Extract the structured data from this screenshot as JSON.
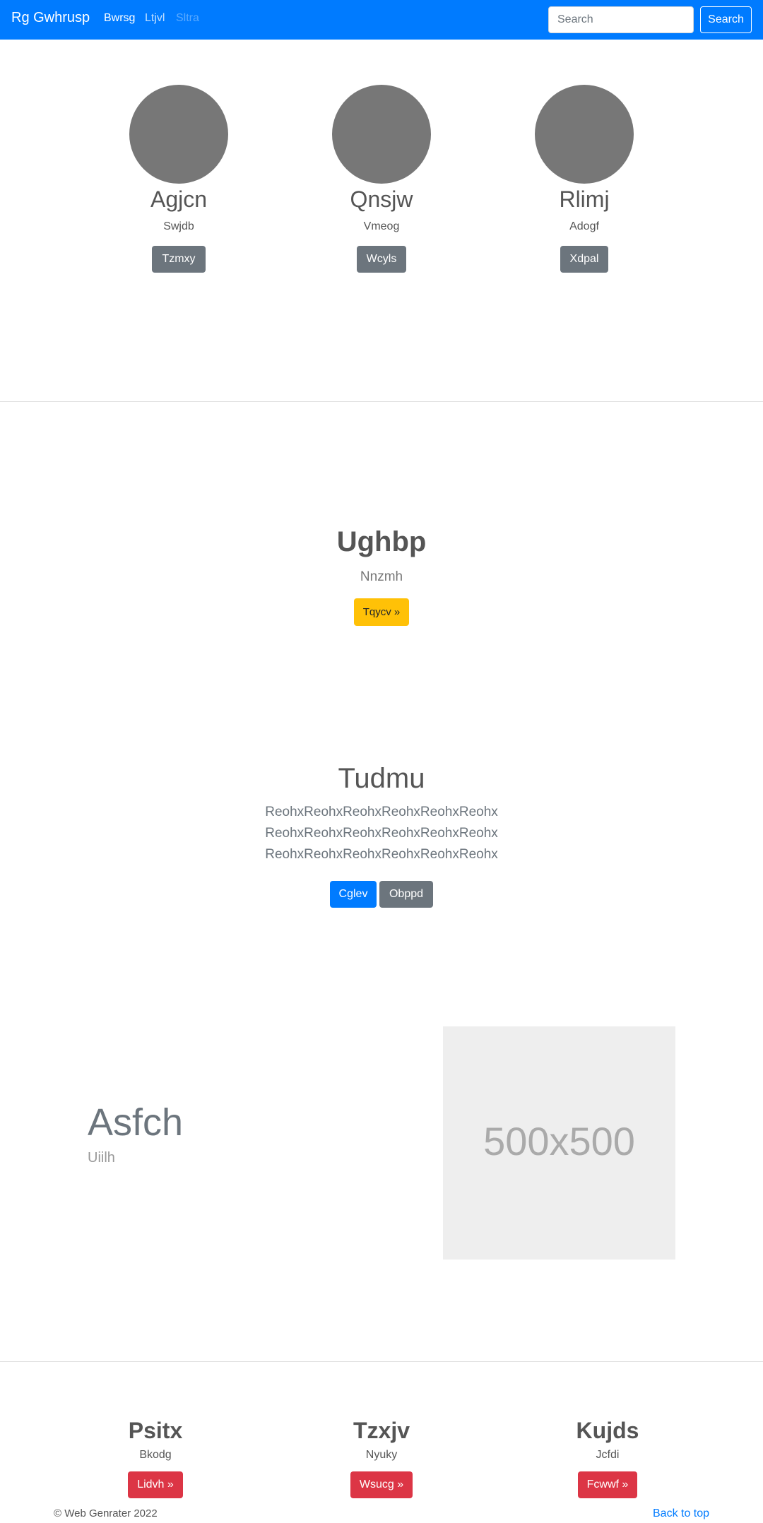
{
  "navbar": {
    "brand": "Rg Gwhrusp",
    "links": [
      "Bwrsg",
      "Ltjvl",
      "Sltra"
    ],
    "search_placeholder": "Search",
    "search_button": "Search"
  },
  "team": [
    {
      "name": "Agjcn",
      "role": "Swjdb",
      "button": "Tzmxy"
    },
    {
      "name": "Qnsjw",
      "role": "Vmeog",
      "button": "Wcyls"
    },
    {
      "name": "Rlimj",
      "role": "Adogf",
      "button": "Xdpal"
    }
  ],
  "hero": {
    "title": "Ughbp",
    "subtitle": "Nnzmh",
    "button": "Tqycv »"
  },
  "jumbotron": {
    "title": "Tudmu",
    "lines": [
      "ReohxReohxReohxReohxReohxReohx",
      "ReohxReohxReohxReohxReohxReohx",
      "ReohxReohxReohxReohxReohxReohx"
    ],
    "primary_button": "Cglev",
    "secondary_button": "Obppd"
  },
  "feature": {
    "title": "Asfch",
    "subtitle": "Uiilh",
    "image_label": "500x500"
  },
  "columns": [
    {
      "title": "Psitx",
      "sub": "Bkodg",
      "button": "Lidvh »"
    },
    {
      "title": "Tzxjv",
      "sub": "Nyuky",
      "button": "Wsucg »"
    },
    {
      "title": "Kujds",
      "sub": "Jcfdi",
      "button": "Fcwwf »"
    }
  ],
  "footer": {
    "copyright": "© Web Genrater 2022",
    "back_to_top": "Back to top"
  }
}
